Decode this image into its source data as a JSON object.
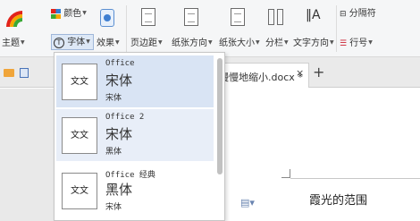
{
  "ribbon": {
    "theme_label": "主题",
    "color_label": "颜色",
    "font_label": "字体",
    "effect_label": "效果",
    "margins_label": "页边距",
    "orientation_label": "纸张方向",
    "size_label": "纸张大小",
    "columns_label": "分栏",
    "text_direction_label": "文字方向",
    "break_label": "分隔符",
    "line_number_label": "行号"
  },
  "tabs": {
    "doc_title": "慢慢地缩小.docx *",
    "close": "×",
    "add": "+"
  },
  "dropdown": {
    "options": [
      {
        "preview": "文文",
        "name": "Office",
        "heading_font": "宋体",
        "body_font": "宋体"
      },
      {
        "preview": "文文",
        "name": "Office 2",
        "heading_font": "宋体",
        "body_font": "黑体"
      },
      {
        "preview": "文文",
        "name": "Office 经典",
        "heading_font": "黑体",
        "body_font": "宋体"
      }
    ]
  },
  "document": {
    "text": "霞光的范围"
  },
  "colors": {
    "ribbon_bg": "#f5f6f7",
    "highlight": "#d9e4f4",
    "doc_bg": "#e9e9e9"
  }
}
